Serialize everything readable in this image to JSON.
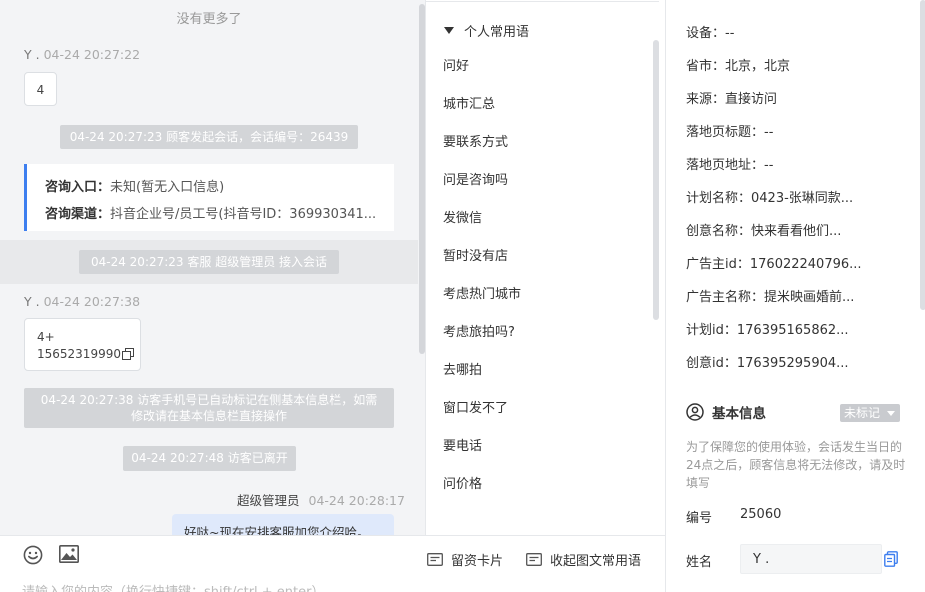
{
  "chat": {
    "no_more": "没有更多了",
    "messages": [
      {
        "sender": "Y .",
        "time": "04-24 20:27:22",
        "text": "4"
      },
      {
        "system": "04-24 20:27:23 顾客发起会话，会话编号：26439"
      },
      {
        "consult": {
          "entry_label": "咨询入口：",
          "entry_value": "未知(暂无入口信息)",
          "channel_label": "咨询渠道：",
          "channel_value": "抖音企业号/员工号(抖音号ID：369930341..."
        }
      },
      {
        "system": "04-24 20:27:23 客服 超级管理员 接入会话"
      },
      {
        "sender": "Y .",
        "time": "04-24 20:27:38",
        "line1": "4+",
        "line2": "15652319990"
      },
      {
        "system_line1": "04-24 20:27:38 访客手机号已自动标记在侧基本信息栏，如需",
        "system_line2": "修改请在基本信息栏直接操作"
      },
      {
        "system": "04-24 20:27:48 访客已离开"
      },
      {
        "sender": "超级管理员",
        "time": "04-24 20:28:17",
        "text": "好哒~现在安排客服加您介绍哈。"
      }
    ]
  },
  "composer": {
    "leave_card": "留资卡片",
    "collapse_phrases": "收起图文常用语",
    "placeholder": "请输入您的内容（换行快捷键：shift/ctrl + enter）"
  },
  "phrases": {
    "header": "个人常用语",
    "items": [
      "问好",
      "城市汇总",
      "要联系方式",
      "问是咨询吗",
      "发微信",
      "暂时没有店",
      "考虑热门城市",
      "考虑旅拍吗?",
      "去哪拍",
      "窗口发不了",
      "要电话",
      "问价格"
    ]
  },
  "info": {
    "rows": [
      {
        "label": "设备：",
        "value": "--"
      },
      {
        "label": "省市：",
        "value": "北京，北京"
      },
      {
        "label": "来源：",
        "value": "直接访问"
      },
      {
        "label": "落地页标题：",
        "value": "--"
      },
      {
        "label": "落地页地址：",
        "value": "--"
      },
      {
        "label": "计划名称：",
        "value": "0423-张琳同款..."
      },
      {
        "label": "创意名称：",
        "value": "快来看看他们..."
      },
      {
        "label": "广告主id：",
        "value": "176022240796..."
      },
      {
        "label": "广告主名称：",
        "value": "提米映画婚前..."
      },
      {
        "label": "计划id：",
        "value": "176395165862..."
      },
      {
        "label": "创意id：",
        "value": "176395295904..."
      }
    ],
    "section_title": "基本信息",
    "tag": "未标记",
    "notice": "为了保障您的使用体验，会话发生当日的24点之后，顾客信息将无法修改，请及时填写",
    "id_label": "编号",
    "id_value": "25060",
    "name_label": "姓名",
    "name_value": "Y ."
  },
  "colors": {
    "accent": "#3d7eef",
    "agent_bubble": "#dfe9fb",
    "system_pill": "#d3d5d8"
  }
}
